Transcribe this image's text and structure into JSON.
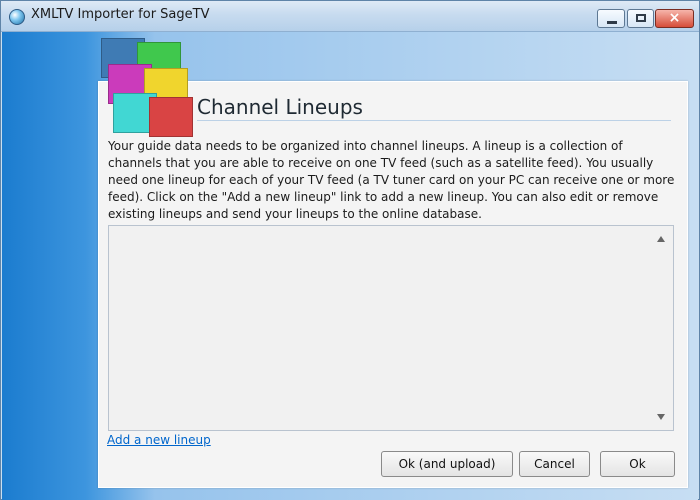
{
  "window": {
    "title": "XMLTV Importer for SageTV",
    "controls": {
      "minimize": "minimize",
      "maximize": "maximize",
      "close": "close"
    }
  },
  "header": {
    "title": "Channel Lineups"
  },
  "description": "Your guide data needs to be organized into channel lineups. A lineup is a collection of channels that you are able to receive on one TV feed (such as a satellite feed). You usually need one lineup for each of your TV feed (a TV tuner card on your PC can receive one or more feed). Click on the \"Add a new lineup\" link to add a new lineup. You can also edit or remove existing lineups and send your lineups to the online database.",
  "lineups": {
    "items": []
  },
  "actions": {
    "add_new_lineup": "Add a new lineup",
    "ok_and_upload": "Ok (and upload)",
    "cancel": "Cancel",
    "ok": "Ok"
  },
  "colors": {
    "accent": "#1b7ccf",
    "panel": "#f4f4f4",
    "link": "#0066cc"
  }
}
